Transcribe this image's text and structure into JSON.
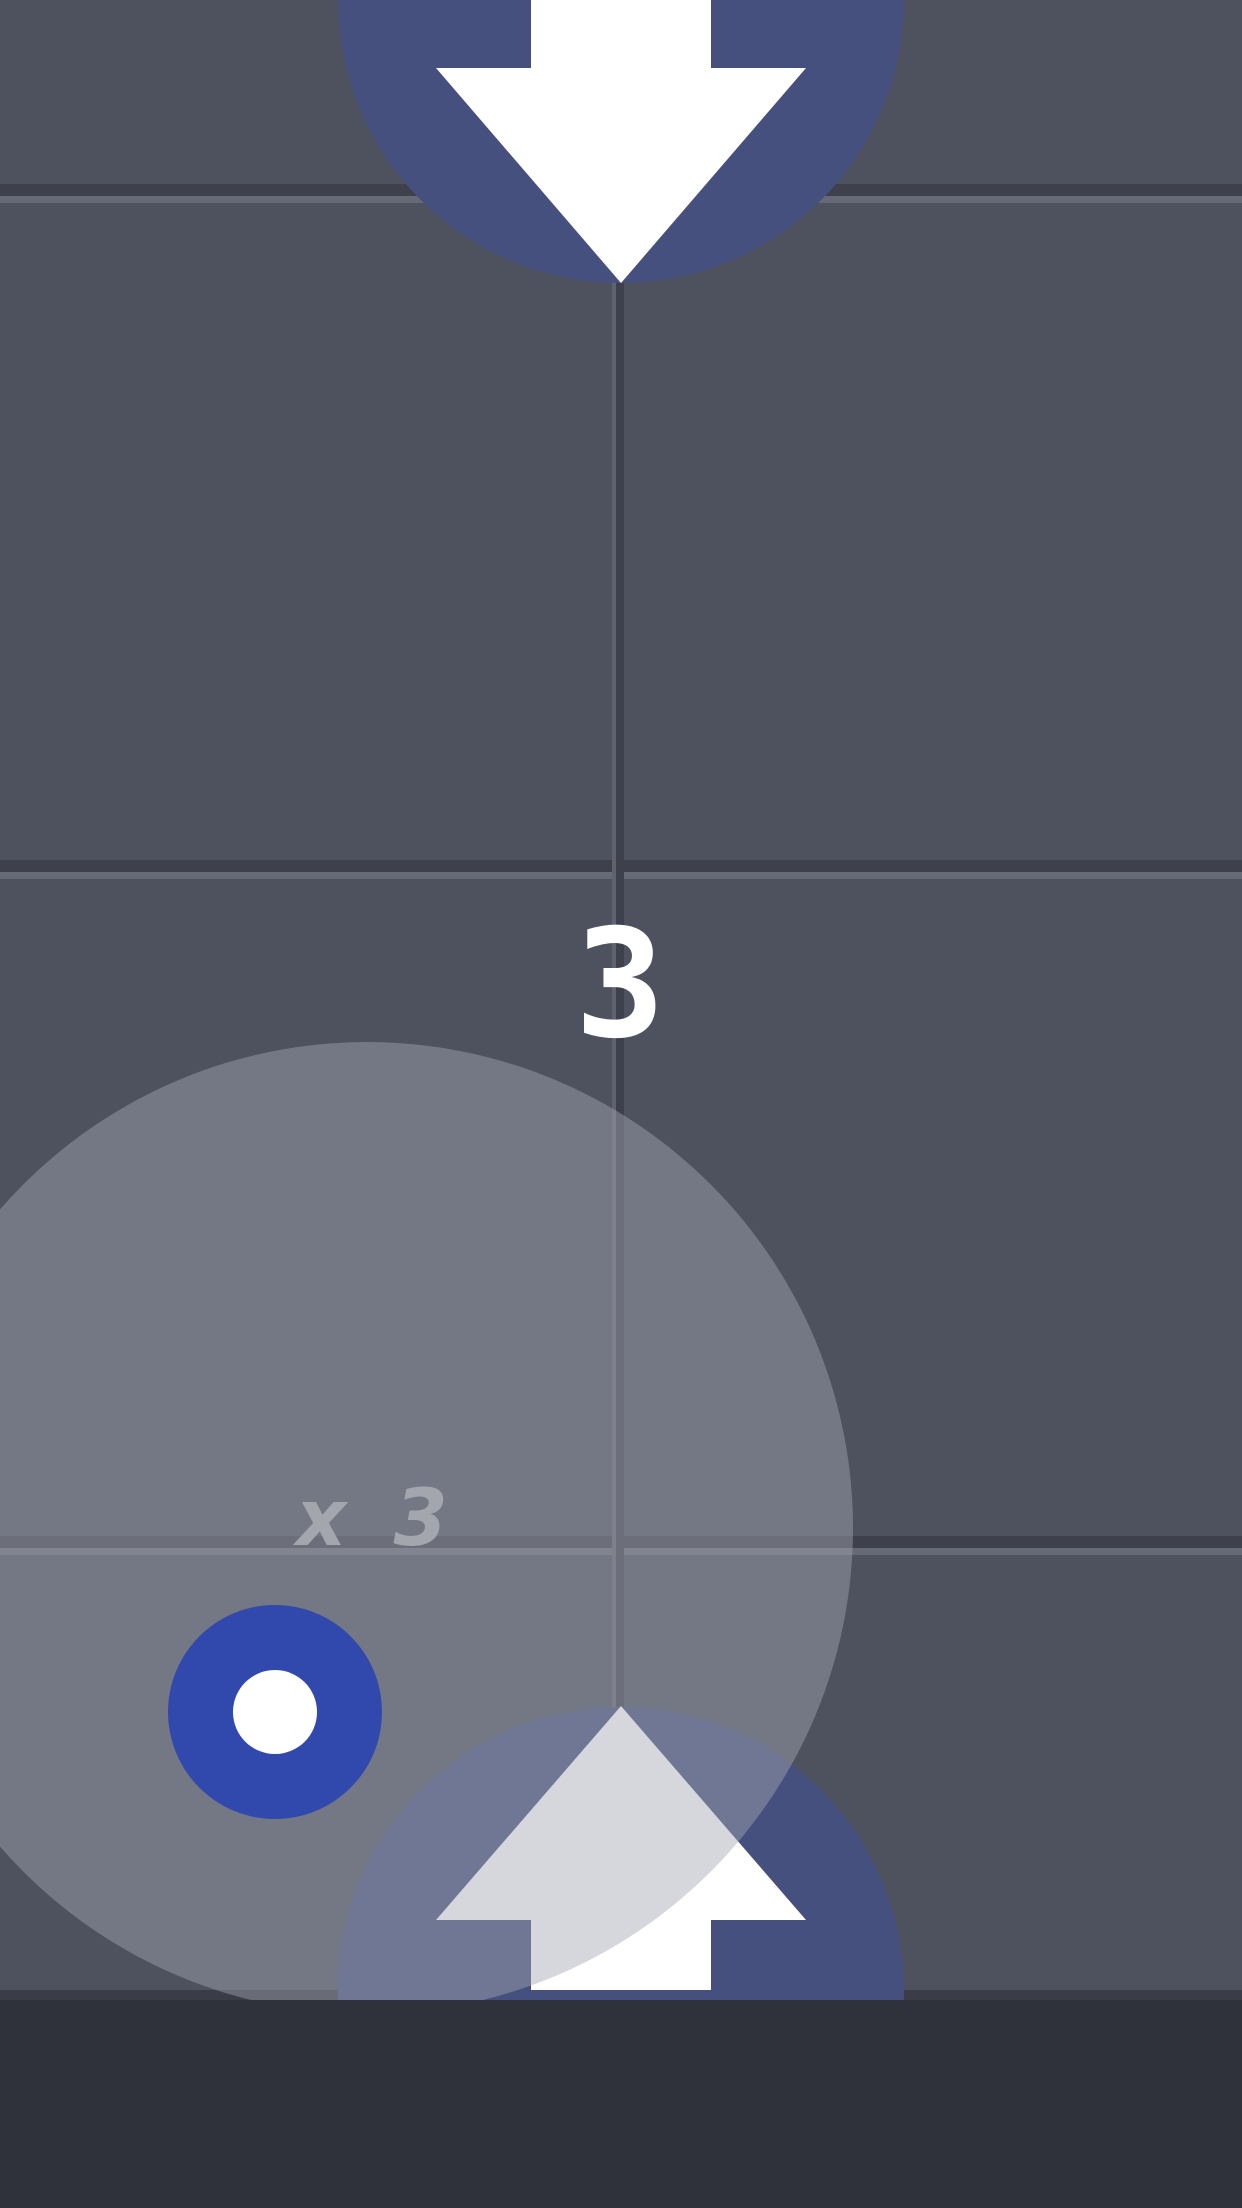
{
  "game": {
    "countdown": "3",
    "multiplier": "x 3"
  },
  "icons": {
    "top_arrow": "arrow-down-icon",
    "bottom_arrow": "arrow-up-icon",
    "player_token": "ring-target-icon"
  },
  "colors": {
    "board": "#4e525f",
    "grid_dark": "#3e414c",
    "grid_light": "#666a76",
    "arrow_circle": "#46507e",
    "player_ring": "#3149ad",
    "overlay": "#8b8e98",
    "bottom_bar": "#2f313b"
  }
}
